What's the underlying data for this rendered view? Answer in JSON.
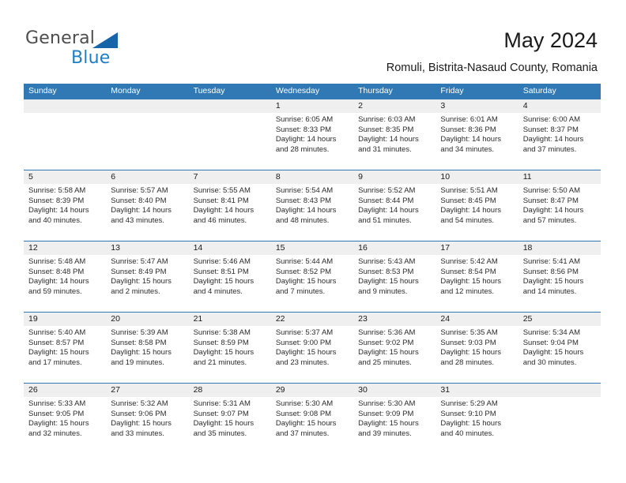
{
  "brand": {
    "name_part1": "General",
    "name_part2": "Blue",
    "triangle_icon": "triangle-icon",
    "accent_blue": "#1f7fc4",
    "logo_gray": "#4d4d4d"
  },
  "header": {
    "title": "May 2024",
    "location": "Romuli, Bistrita-Nasaud County, Romania"
  },
  "colors": {
    "header_row_bg": "#3179b4",
    "day_number_bg": "#efefef",
    "text": "#2b2b2b"
  },
  "weekdays": [
    "Sunday",
    "Monday",
    "Tuesday",
    "Wednesday",
    "Thursday",
    "Friday",
    "Saturday"
  ],
  "weeks": [
    {
      "days": [
        {
          "num": "",
          "sunrise": "",
          "sunset": "",
          "daylight_line1": "",
          "daylight_line2": ""
        },
        {
          "num": "",
          "sunrise": "",
          "sunset": "",
          "daylight_line1": "",
          "daylight_line2": ""
        },
        {
          "num": "",
          "sunrise": "",
          "sunset": "",
          "daylight_line1": "",
          "daylight_line2": ""
        },
        {
          "num": "1",
          "sunrise": "Sunrise: 6:05 AM",
          "sunset": "Sunset: 8:33 PM",
          "daylight_line1": "Daylight: 14 hours",
          "daylight_line2": "and 28 minutes."
        },
        {
          "num": "2",
          "sunrise": "Sunrise: 6:03 AM",
          "sunset": "Sunset: 8:35 PM",
          "daylight_line1": "Daylight: 14 hours",
          "daylight_line2": "and 31 minutes."
        },
        {
          "num": "3",
          "sunrise": "Sunrise: 6:01 AM",
          "sunset": "Sunset: 8:36 PM",
          "daylight_line1": "Daylight: 14 hours",
          "daylight_line2": "and 34 minutes."
        },
        {
          "num": "4",
          "sunrise": "Sunrise: 6:00 AM",
          "sunset": "Sunset: 8:37 PM",
          "daylight_line1": "Daylight: 14 hours",
          "daylight_line2": "and 37 minutes."
        }
      ]
    },
    {
      "days": [
        {
          "num": "5",
          "sunrise": "Sunrise: 5:58 AM",
          "sunset": "Sunset: 8:39 PM",
          "daylight_line1": "Daylight: 14 hours",
          "daylight_line2": "and 40 minutes."
        },
        {
          "num": "6",
          "sunrise": "Sunrise: 5:57 AM",
          "sunset": "Sunset: 8:40 PM",
          "daylight_line1": "Daylight: 14 hours",
          "daylight_line2": "and 43 minutes."
        },
        {
          "num": "7",
          "sunrise": "Sunrise: 5:55 AM",
          "sunset": "Sunset: 8:41 PM",
          "daylight_line1": "Daylight: 14 hours",
          "daylight_line2": "and 46 minutes."
        },
        {
          "num": "8",
          "sunrise": "Sunrise: 5:54 AM",
          "sunset": "Sunset: 8:43 PM",
          "daylight_line1": "Daylight: 14 hours",
          "daylight_line2": "and 48 minutes."
        },
        {
          "num": "9",
          "sunrise": "Sunrise: 5:52 AM",
          "sunset": "Sunset: 8:44 PM",
          "daylight_line1": "Daylight: 14 hours",
          "daylight_line2": "and 51 minutes."
        },
        {
          "num": "10",
          "sunrise": "Sunrise: 5:51 AM",
          "sunset": "Sunset: 8:45 PM",
          "daylight_line1": "Daylight: 14 hours",
          "daylight_line2": "and 54 minutes."
        },
        {
          "num": "11",
          "sunrise": "Sunrise: 5:50 AM",
          "sunset": "Sunset: 8:47 PM",
          "daylight_line1": "Daylight: 14 hours",
          "daylight_line2": "and 57 minutes."
        }
      ]
    },
    {
      "days": [
        {
          "num": "12",
          "sunrise": "Sunrise: 5:48 AM",
          "sunset": "Sunset: 8:48 PM",
          "daylight_line1": "Daylight: 14 hours",
          "daylight_line2": "and 59 minutes."
        },
        {
          "num": "13",
          "sunrise": "Sunrise: 5:47 AM",
          "sunset": "Sunset: 8:49 PM",
          "daylight_line1": "Daylight: 15 hours",
          "daylight_line2": "and 2 minutes."
        },
        {
          "num": "14",
          "sunrise": "Sunrise: 5:46 AM",
          "sunset": "Sunset: 8:51 PM",
          "daylight_line1": "Daylight: 15 hours",
          "daylight_line2": "and 4 minutes."
        },
        {
          "num": "15",
          "sunrise": "Sunrise: 5:44 AM",
          "sunset": "Sunset: 8:52 PM",
          "daylight_line1": "Daylight: 15 hours",
          "daylight_line2": "and 7 minutes."
        },
        {
          "num": "16",
          "sunrise": "Sunrise: 5:43 AM",
          "sunset": "Sunset: 8:53 PM",
          "daylight_line1": "Daylight: 15 hours",
          "daylight_line2": "and 9 minutes."
        },
        {
          "num": "17",
          "sunrise": "Sunrise: 5:42 AM",
          "sunset": "Sunset: 8:54 PM",
          "daylight_line1": "Daylight: 15 hours",
          "daylight_line2": "and 12 minutes."
        },
        {
          "num": "18",
          "sunrise": "Sunrise: 5:41 AM",
          "sunset": "Sunset: 8:56 PM",
          "daylight_line1": "Daylight: 15 hours",
          "daylight_line2": "and 14 minutes."
        }
      ]
    },
    {
      "days": [
        {
          "num": "19",
          "sunrise": "Sunrise: 5:40 AM",
          "sunset": "Sunset: 8:57 PM",
          "daylight_line1": "Daylight: 15 hours",
          "daylight_line2": "and 17 minutes."
        },
        {
          "num": "20",
          "sunrise": "Sunrise: 5:39 AM",
          "sunset": "Sunset: 8:58 PM",
          "daylight_line1": "Daylight: 15 hours",
          "daylight_line2": "and 19 minutes."
        },
        {
          "num": "21",
          "sunrise": "Sunrise: 5:38 AM",
          "sunset": "Sunset: 8:59 PM",
          "daylight_line1": "Daylight: 15 hours",
          "daylight_line2": "and 21 minutes."
        },
        {
          "num": "22",
          "sunrise": "Sunrise: 5:37 AM",
          "sunset": "Sunset: 9:00 PM",
          "daylight_line1": "Daylight: 15 hours",
          "daylight_line2": "and 23 minutes."
        },
        {
          "num": "23",
          "sunrise": "Sunrise: 5:36 AM",
          "sunset": "Sunset: 9:02 PM",
          "daylight_line1": "Daylight: 15 hours",
          "daylight_line2": "and 25 minutes."
        },
        {
          "num": "24",
          "sunrise": "Sunrise: 5:35 AM",
          "sunset": "Sunset: 9:03 PM",
          "daylight_line1": "Daylight: 15 hours",
          "daylight_line2": "and 28 minutes."
        },
        {
          "num": "25",
          "sunrise": "Sunrise: 5:34 AM",
          "sunset": "Sunset: 9:04 PM",
          "daylight_line1": "Daylight: 15 hours",
          "daylight_line2": "and 30 minutes."
        }
      ]
    },
    {
      "days": [
        {
          "num": "26",
          "sunrise": "Sunrise: 5:33 AM",
          "sunset": "Sunset: 9:05 PM",
          "daylight_line1": "Daylight: 15 hours",
          "daylight_line2": "and 32 minutes."
        },
        {
          "num": "27",
          "sunrise": "Sunrise: 5:32 AM",
          "sunset": "Sunset: 9:06 PM",
          "daylight_line1": "Daylight: 15 hours",
          "daylight_line2": "and 33 minutes."
        },
        {
          "num": "28",
          "sunrise": "Sunrise: 5:31 AM",
          "sunset": "Sunset: 9:07 PM",
          "daylight_line1": "Daylight: 15 hours",
          "daylight_line2": "and 35 minutes."
        },
        {
          "num": "29",
          "sunrise": "Sunrise: 5:30 AM",
          "sunset": "Sunset: 9:08 PM",
          "daylight_line1": "Daylight: 15 hours",
          "daylight_line2": "and 37 minutes."
        },
        {
          "num": "30",
          "sunrise": "Sunrise: 5:30 AM",
          "sunset": "Sunset: 9:09 PM",
          "daylight_line1": "Daylight: 15 hours",
          "daylight_line2": "and 39 minutes."
        },
        {
          "num": "31",
          "sunrise": "Sunrise: 5:29 AM",
          "sunset": "Sunset: 9:10 PM",
          "daylight_line1": "Daylight: 15 hours",
          "daylight_line2": "and 40 minutes."
        },
        {
          "num": "",
          "sunrise": "",
          "sunset": "",
          "daylight_line1": "",
          "daylight_line2": ""
        }
      ]
    }
  ]
}
